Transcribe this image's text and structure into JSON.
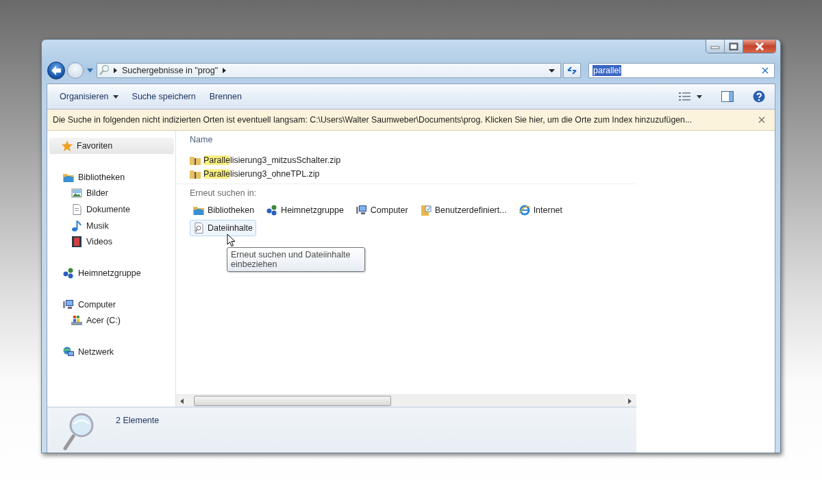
{
  "address_bar": {
    "breadcrumb": [
      "Suchergebnisse in \"prog\""
    ]
  },
  "search_field": {
    "value": "parallel",
    "text_selected": true
  },
  "toolbar": {
    "buttons": [
      {
        "label": "Organisieren",
        "kind": "menu"
      },
      {
        "label": "Suche speichern",
        "kind": "plain"
      },
      {
        "label": "Brennen",
        "kind": "plain"
      }
    ]
  },
  "info_bar": {
    "message": "Die Suche in folgenden nicht indizierten Orten ist eventuell langsam: C:\\Users\\Walter Saumweber\\Documents\\prog. Klicken Sie hier, um die Orte zum Index hinzuzufügen..."
  },
  "navigation": {
    "items": [
      {
        "label": "Favoriten",
        "selected": true
      },
      {
        "label": "Bibliotheken",
        "selected": false,
        "children": [
          {
            "label": "Bilder",
            "selected": false
          },
          {
            "label": "Dokumente",
            "selected": false
          },
          {
            "label": "Musik",
            "selected": false
          },
          {
            "label": "Videos",
            "selected": false
          }
        ]
      },
      {
        "label": "Heimnetzgruppe",
        "selected": false
      },
      {
        "label": "Computer",
        "selected": false,
        "children": [
          {
            "label": "Acer (C:)",
            "selected": false
          }
        ]
      },
      {
        "label": "Netzwerk",
        "selected": false
      }
    ]
  },
  "file_list": {
    "column": "Name",
    "files": [
      {
        "match": "Paralle",
        "rest": "lisierung3_mitzusSchalter.zip"
      },
      {
        "match": "Paralle",
        "rest": "lisierung3_ohneTPL.zip"
      }
    ]
  },
  "search_again": {
    "heading": "Erneut suchen in:",
    "items": [
      {
        "label": "Bibliotheken",
        "hovered": false
      },
      {
        "label": "Heimnetzgruppe",
        "hovered": false
      },
      {
        "label": "Computer",
        "hovered": false
      },
      {
        "label": "Benutzerdefiniert...",
        "hovered": false
      },
      {
        "label": "Internet",
        "hovered": false
      },
      {
        "label": "Dateiinhalte",
        "hovered": true
      }
    ]
  },
  "tooltip": {
    "text": "Erneut suchen und Dateiinhalte einbeziehen"
  },
  "status_bar": {
    "count": "2 Elemente"
  }
}
